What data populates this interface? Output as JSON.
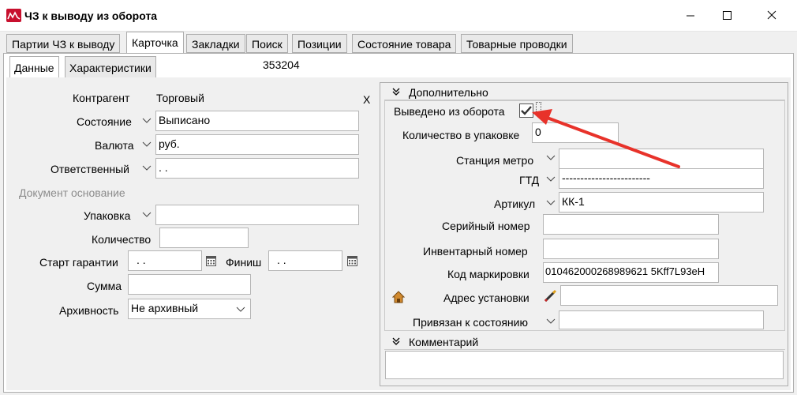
{
  "window": {
    "title": "ЧЗ к выводу из оборота"
  },
  "tabs": [
    {
      "label": "Партии ЧЗ к выводу"
    },
    {
      "label": "Карточка"
    },
    {
      "label": "Закладки"
    },
    {
      "label": "Поиск"
    },
    {
      "label": "Позиции"
    },
    {
      "label": "Состояние товара"
    },
    {
      "label": "Товарные проводки"
    }
  ],
  "subtabs": [
    {
      "label": "Данные"
    },
    {
      "label": "Характеристики"
    }
  ],
  "record_id": "353204",
  "left": {
    "kontragent_label": "Контрагент",
    "kontragent_value": "Торговый",
    "clear_label": "X",
    "sostoyanie_label": "Состояние",
    "sostoyanie_value": "Выписано",
    "valyuta_label": "Валюта",
    "valyuta_value": "руб.",
    "otvetstvenny_label": "Ответственный",
    "otvetstvenny_value": ". .",
    "dokument_label": "Документ основание",
    "upakovka_label": "Упаковка",
    "upakovka_value": "",
    "kolichestvo_label": "Количество",
    "kolichestvo_value": "",
    "start_label": "Старт гарантии",
    "start_value": ". .",
    "finish_label": "Финиш",
    "finish_value": ". .",
    "summa_label": "Сумма",
    "summa_value": "",
    "arkhivnost_label": "Архивность",
    "arkhivnost_value": "Не архивный"
  },
  "right": {
    "section_title": "Дополнительно",
    "vyvedeno_label": "Выведено из оборота",
    "vyvedeno_checked": true,
    "kol_upak_label": "Количество в упаковке",
    "kol_upak_value": "0",
    "stanciya_label": "Станция метро",
    "stanciya_value": "",
    "gtd_label": "ГТД",
    "gtd_value": "------------------------",
    "artikul_label": "Артикул",
    "artikul_value": "КК-1",
    "serial_label": "Серийный номер",
    "serial_value": "",
    "inventar_label": "Инвентарный номер",
    "inventar_value": "",
    "kod_label": "Код маркировки",
    "kod_value": "010462000268989621 5Kff7L93eH",
    "adres_label": "Адрес установки",
    "adres_value": "",
    "privyazan_label": "Привязан к состоянию",
    "privyazan_value": "",
    "comment_title": "Комментарий",
    "comment_value": ""
  },
  "colors": {
    "annotation_arrow": "#e8322a",
    "logo": "#c8102e",
    "checkmark": "#333333"
  },
  "icons": [
    "app-logo-icon",
    "minimize-icon",
    "maximize-icon",
    "close-icon",
    "chevron-down-icon",
    "calendar-icon",
    "collapse-icon",
    "house-icon",
    "pencil-icon",
    "checkmark-icon"
  ]
}
